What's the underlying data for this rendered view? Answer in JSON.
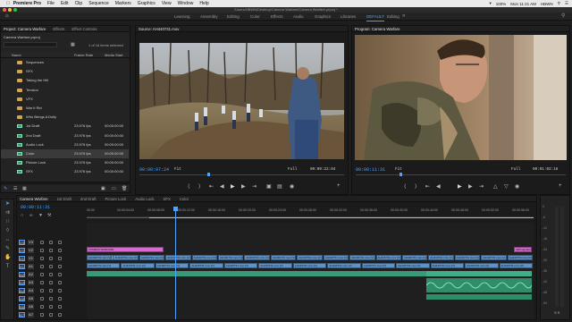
{
  "menubar": {
    "apple": "",
    "app": "Premiere Pro",
    "items": [
      "File",
      "Edit",
      "Clip",
      "Sequence",
      "Markers",
      "Graphics",
      "View",
      "Window",
      "Help"
    ],
    "battery": "100%",
    "clock": "Mon 11:21 AM",
    "user": "HBWN"
  },
  "window": {
    "title": "/Users/HBWN/Desktop/Camera Warfare/Camera Warfare.prproj *"
  },
  "workspaces": {
    "items": [
      "Learning",
      "Assembly",
      "Editing",
      "Color",
      "Effects",
      "Audio",
      "Graphics",
      "Libraries",
      "DEFAULT",
      "Editing"
    ],
    "active": "DEFAULT"
  },
  "project": {
    "tabs": [
      "Project: Camera Warfare",
      "Effects",
      "Effect Controls"
    ],
    "path": "Camera Warfare.prproj",
    "search_placeholder": "",
    "selection": "1 of 16 items selected",
    "columns": [
      "Name",
      "Frame Rate",
      "Media Start"
    ],
    "items": [
      {
        "name": "Sequences",
        "fps": "",
        "start": "",
        "type": "folder"
      },
      {
        "name": "SFX",
        "fps": "",
        "start": "",
        "type": "folder"
      },
      {
        "name": "Taking the Hill",
        "fps": "",
        "start": "",
        "type": "folder"
      },
      {
        "name": "Tension",
        "fps": "",
        "start": "",
        "type": "folder"
      },
      {
        "name": "VFX",
        "fps": "",
        "start": "",
        "type": "folder"
      },
      {
        "name": "War It Rid",
        "fps": "",
        "start": "",
        "type": "folder"
      },
      {
        "name": "Who Brings A Dolly",
        "fps": "",
        "start": "",
        "type": "folder"
      },
      {
        "name": "1st Draft",
        "fps": "23.976 fps",
        "start": "00:00:00:00",
        "type": "sequence"
      },
      {
        "name": "2nd Draft",
        "fps": "23.976 fps",
        "start": "00:00:00:00",
        "type": "sequence"
      },
      {
        "name": "Audio Lock",
        "fps": "23.976 fps",
        "start": "00:00:00:00",
        "type": "sequence"
      },
      {
        "name": "Color",
        "fps": "23.976 fps",
        "start": "00:00:00:00",
        "type": "sequence"
      },
      {
        "name": "Picture Lock",
        "fps": "23.976 fps",
        "start": "00:00:00:00",
        "type": "sequence"
      },
      {
        "name": "SFX",
        "fps": "23.976 fps",
        "start": "00:00:00:00",
        "type": "sequence"
      }
    ]
  },
  "source": {
    "title": "Source: AH440731.mov",
    "timecode": "00:00:07:24",
    "fit": "Fit",
    "quality": "Full",
    "duration": "00:00:22:04"
  },
  "program": {
    "title": "Program: Camera Warfare",
    "timecode": "00:00:11:31",
    "fit": "Fit",
    "quality": "Full",
    "duration": "00:01:02:16"
  },
  "timeline": {
    "tabs": [
      "Camera Warfare",
      "1st Draft",
      "2nd Draft",
      "Picture Lock",
      "Audio Lock",
      "SFX",
      "Color"
    ],
    "timecode": "00:00:11:31",
    "ruler": [
      "00:00",
      "00:00:04:00",
      "00:00:08:00",
      "00:00:12:00",
      "00:00:16:00",
      "00:00:20:00",
      "00:00:24:00",
      "00:00:28:00",
      "00:00:32:00",
      "00:00:36:00",
      "00:00:40:00",
      "00:00:44:00",
      "00:00:48:00",
      "00:00:52:00",
      "00:00:56:00"
    ],
    "tracks": [
      "V3",
      "V2",
      "V1",
      "A1",
      "A2",
      "A3",
      "A4",
      "A5",
      "A6",
      "A7"
    ],
    "clips": {
      "title": "CAMERA WARFARE",
      "adjustment": "Adjustment Layer",
      "end": "ARCsignature",
      "v1": "AH440731.mov [V]"
    }
  },
  "meter": {
    "labels": [
      "0",
      "-6",
      "-12",
      "-18",
      "-24",
      "-30",
      "-36",
      "-42",
      "-48",
      "-54"
    ],
    "footer": "S S"
  },
  "colors": {
    "accent": "#4da3ff",
    "video_clip": "#5e93c9",
    "title_clip": "#d86bd0",
    "adjust_clip": "#c9a05a",
    "audio_clip": "#3fae8b",
    "timeline_bg": "#1b1b1b"
  }
}
